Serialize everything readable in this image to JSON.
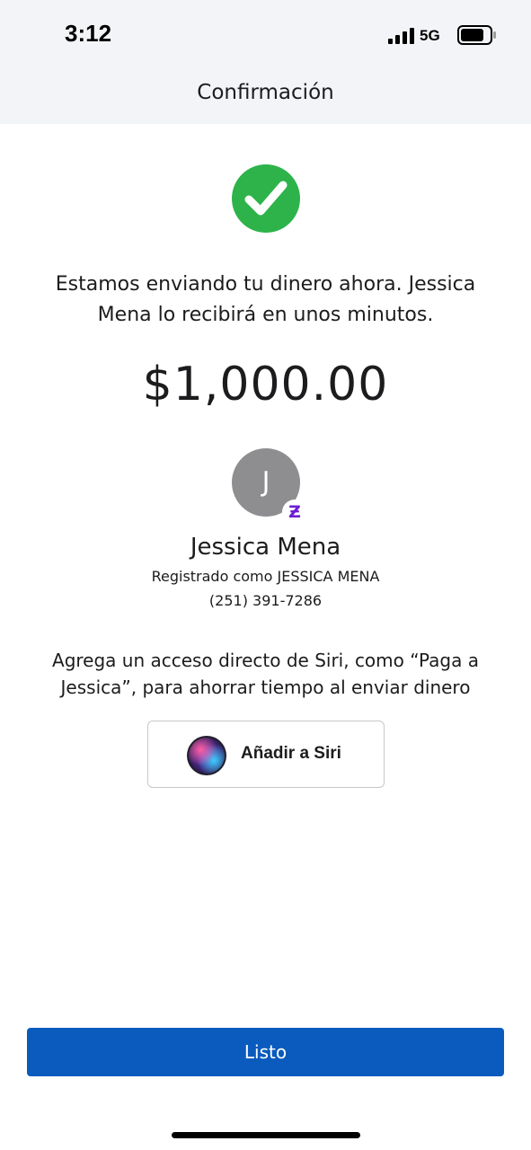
{
  "status_bar": {
    "time": "3:12",
    "network": "5G",
    "signal_icon": "signal-bars-icon",
    "battery_icon": "battery-icon"
  },
  "nav": {
    "title": "Confirmación"
  },
  "confirmation": {
    "icon": "check-circle-icon",
    "icon_color": "#2db34a",
    "message": "Estamos enviando tu dinero ahora. Jessica Mena lo recibirá en unos minutos.",
    "amount": "$1,000.00"
  },
  "recipient": {
    "initial": "J",
    "badge": "Ƶ",
    "badge_icon": "zelle-badge-icon",
    "badge_color": "#6d1ed4",
    "name": "Jessica Mena",
    "registered_as": "Registrado como JESSICA MENA",
    "phone": "(251) 391-7286"
  },
  "siri": {
    "hint": "Agrega un acceso directo de Siri, como “Paga a Jessica”, para ahorrar tiempo al enviar dinero",
    "icon": "siri-icon",
    "button_label": "Añadir a Siri"
  },
  "footer": {
    "done_label": "Listo",
    "done_color": "#0a5bbd"
  }
}
